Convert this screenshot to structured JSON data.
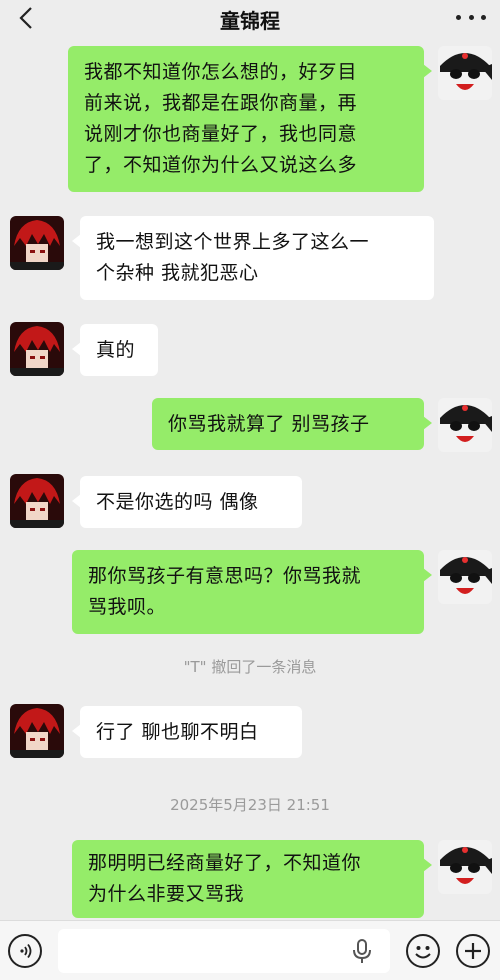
{
  "header": {
    "title": "童锦程",
    "back_icon": "chevron-left-icon",
    "more_icon": "more-dots-icon"
  },
  "messages": [
    {
      "sender": "me",
      "text": "我都不知道你怎么想的，好歹目\n前来说，我都是在跟你商量，再\n说刚才你也商量好了，我也同意\n了，不知道你为什么又说这么多"
    },
    {
      "sender": "them",
      "text": "我一想到这个世界上多了这么一\n个杂种 我就犯恶心"
    },
    {
      "sender": "them",
      "text": "真的"
    },
    {
      "sender": "me",
      "text": "你骂我就算了 别骂孩子"
    },
    {
      "sender": "them",
      "text": "不是你选的吗 偶像"
    },
    {
      "sender": "me",
      "text": "那你骂孩子有意思吗？你骂我就\n骂我呗。"
    },
    {
      "sender": "them",
      "text": "行了 聊也聊不明白"
    },
    {
      "sender": "me",
      "text": "那明明已经商量好了，不知道你\n为什么非要又骂我"
    }
  ],
  "system_notices": {
    "recall": "\"T\" 撤回了一条消息",
    "timestamp": "2025年5月23日 21:51"
  },
  "input_bar": {
    "voice_icon": "voice-wave-icon",
    "mic_icon": "microphone-icon",
    "emoji_icon": "smiley-icon",
    "plus_icon": "plus-icon"
  },
  "colors": {
    "background": "#ededed",
    "my_bubble": "#95ec69",
    "their_bubble": "#ffffff",
    "system_text": "#9a9a9a"
  }
}
